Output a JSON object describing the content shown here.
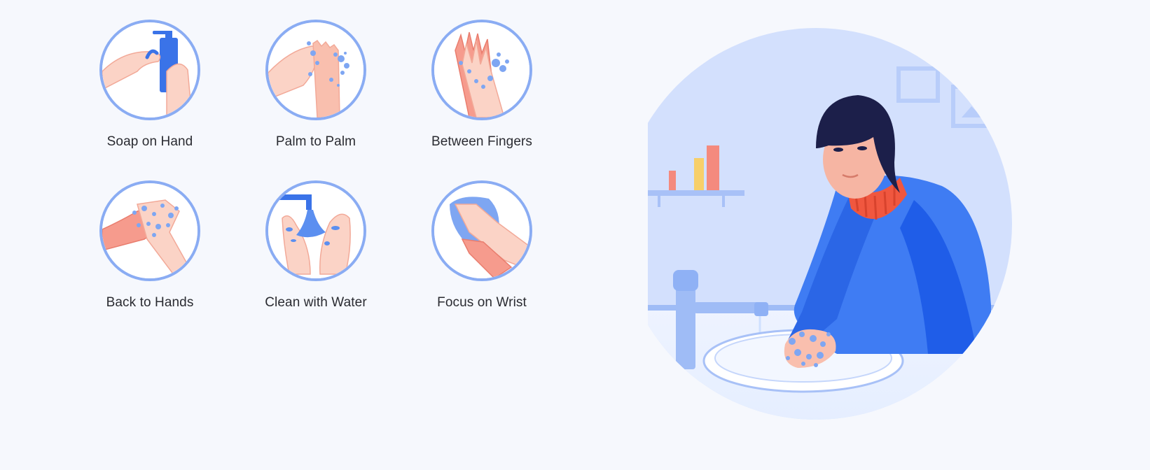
{
  "steps": [
    {
      "label": "Soap on Hand",
      "icon": "soap-dispenser-hand-icon"
    },
    {
      "label": "Palm to Palm",
      "icon": "palm-to-palm-icon"
    },
    {
      "label": "Between Fingers",
      "icon": "between-fingers-icon"
    },
    {
      "label": "Back to Hands",
      "icon": "back-to-hands-icon"
    },
    {
      "label": "Clean with Water",
      "icon": "rinse-water-icon"
    },
    {
      "label": "Focus on Wrist",
      "icon": "towel-wrist-icon"
    }
  ],
  "colors": {
    "background": "#f6f8fd",
    "ring": "#8aacf3",
    "skin": "#f9c4b5",
    "accent_blue": "#2e6ef5",
    "foam": "#6f9df0",
    "scarf": "#f0573f"
  },
  "hero": {
    "icon": "person-washing-hands-illustration"
  }
}
